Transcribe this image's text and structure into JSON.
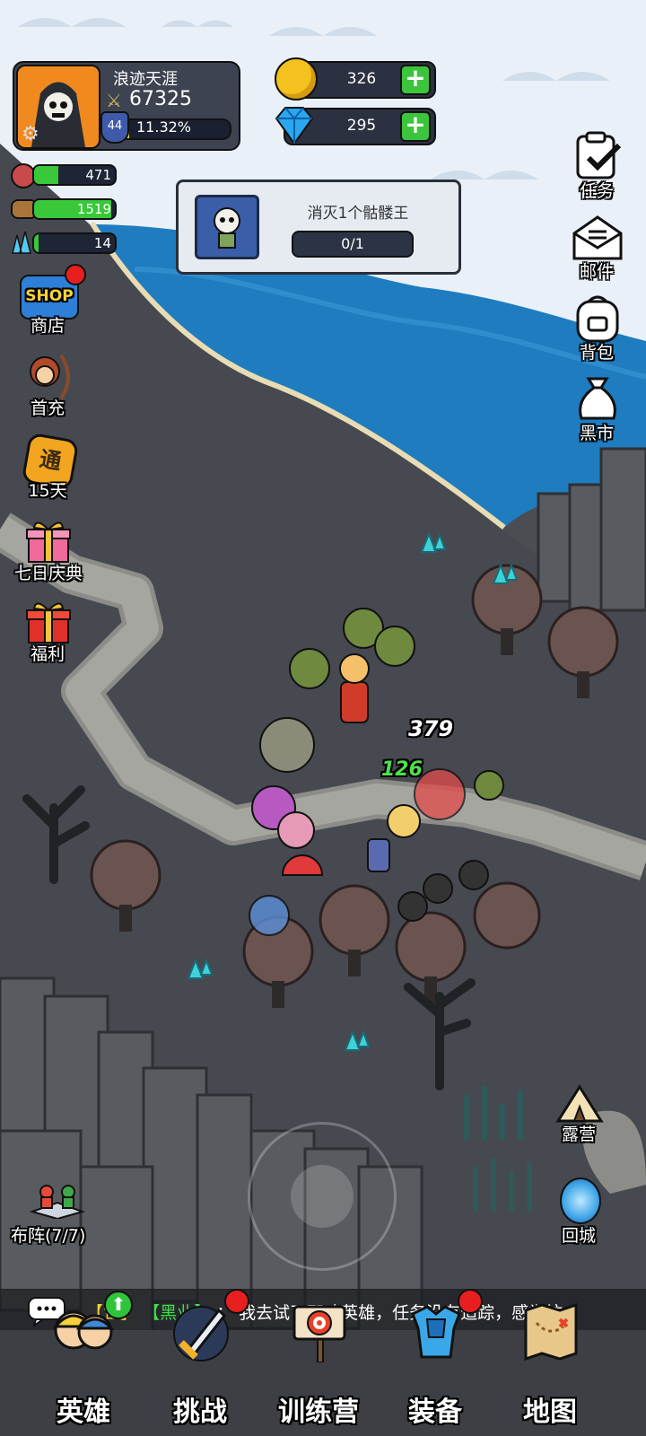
{
  "player": {
    "name": "浪迹天涯",
    "power": "67325",
    "level": "44",
    "exp_percent": "11.32%"
  },
  "currency": {
    "gold": "326",
    "diamond": "295"
  },
  "resources": [
    {
      "icon": "meat-icon",
      "value": "471",
      "fill": 0.3
    },
    {
      "icon": "wood-icon",
      "value": "1519",
      "fill": 0.95
    },
    {
      "icon": "crystal-icon",
      "value": "14",
      "fill": 0.05
    }
  ],
  "quest": {
    "title": "消灭1个骷髅王",
    "progress": "0/1"
  },
  "left_menu": [
    "商店",
    "首充",
    "15天",
    "七日庆典",
    "福利"
  ],
  "shop_badge": "SHOP",
  "pass_badge": "通",
  "right_menu": [
    "任务",
    "邮件",
    "背包",
    "黑市"
  ],
  "map_buttons": {
    "camp": "露营",
    "return": "回城",
    "formation": "布阵(7/7)"
  },
  "damage_numbers": {
    "white": "379",
    "green": "126"
  },
  "chat": {
    "channel": "【世】",
    "sender": "【黑业】",
    "message": "：  我去试了那啥英雄，任务没有追踪，感觉坑"
  },
  "bottom_nav": [
    "英雄",
    "挑战",
    "训练营",
    "装备",
    "地图"
  ],
  "colors": {
    "sea": "#1f7fc0",
    "cloud": "#e8f0f8",
    "ground": "#46494f",
    "road": "#8a8a86",
    "accent_green": "#3cc43c"
  }
}
